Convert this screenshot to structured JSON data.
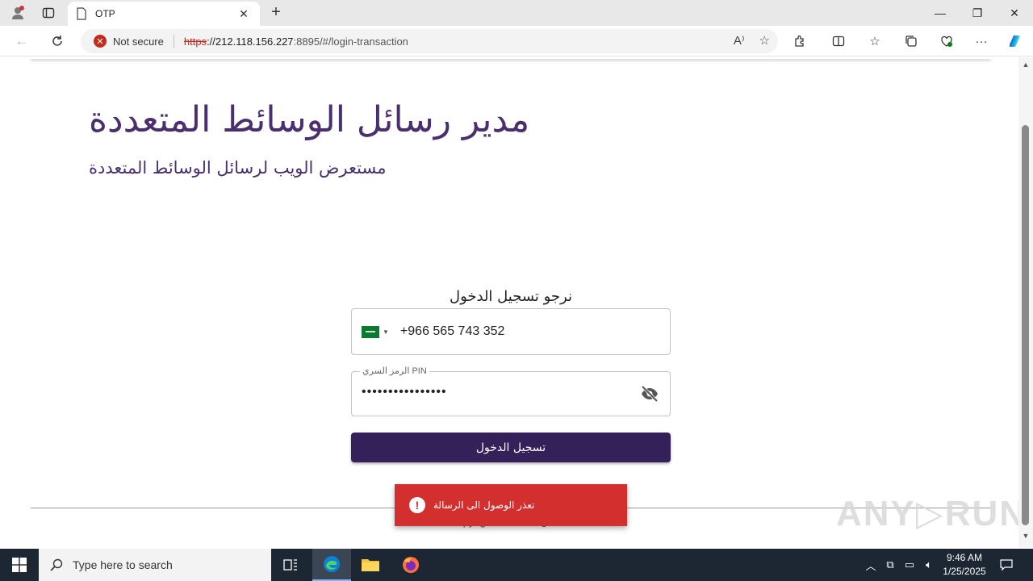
{
  "browser": {
    "tab_title": "OTP",
    "security_label": "Not secure",
    "url_proto": "https",
    "url_host": "://212.118.156.227",
    "url_rest": ":8895/#/login-transaction"
  },
  "page": {
    "title": "مدير رسائل الوسائط المتعددة",
    "subtitle": "مستعرض الويب لرسائل الوسائط المتعددة",
    "login_heading": "نرجو تسجيل الدخول",
    "phone_value": "+966 565 743 352",
    "pin_label": "الرمز السري PIN",
    "pin_value": "••••••••••••••••",
    "login_button": "تسجيل الدخول",
    "footer_text": "Copyright © 2025 - المشغل",
    "toast_message": "تعذر الوصول الى الرسالة",
    "watermark": "ANY▷RUN"
  },
  "taskbar": {
    "search_placeholder": "Type here to search",
    "time": "9:46 AM",
    "date": "1/25/2025"
  },
  "colors": {
    "brand_purple": "#4a2f6e",
    "button_purple": "#34215a",
    "error_red": "#d32f2f",
    "flag_green": "#0a7a32"
  }
}
